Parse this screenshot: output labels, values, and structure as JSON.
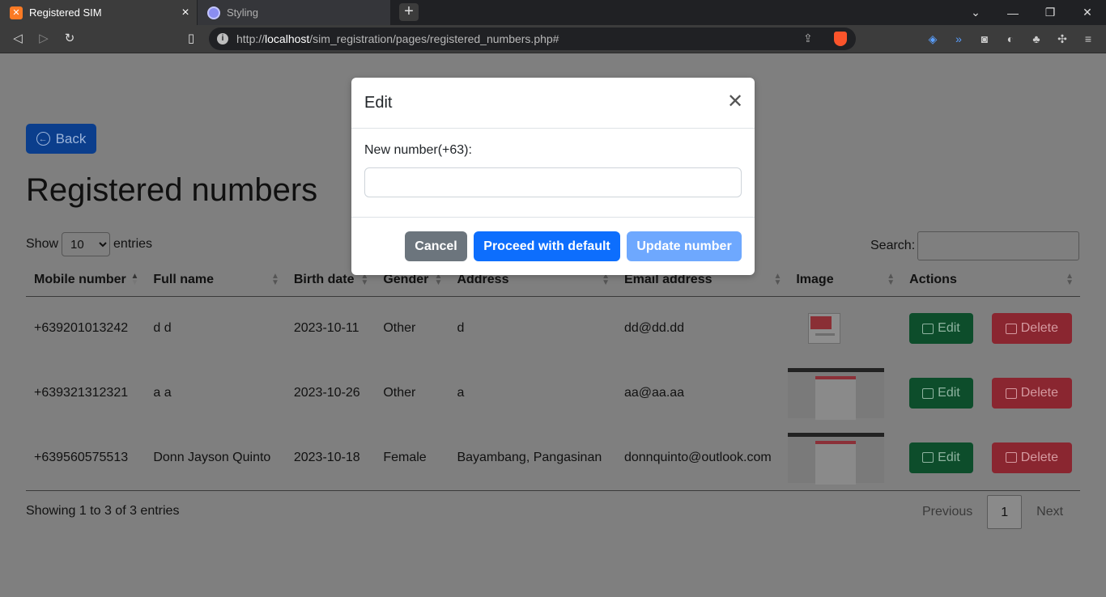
{
  "browser": {
    "tabs": [
      {
        "title": "Registered SIM",
        "icon": "xampp-icon",
        "active": true
      },
      {
        "title": "Styling",
        "icon": "globe-icon",
        "active": false
      }
    ],
    "url_prefix": "http://",
    "url_host": "localhost",
    "url_path": "/sim_registration/pages/registered_numbers.php#"
  },
  "page": {
    "back_label": "Back",
    "title": "Registered numbers",
    "show_label": "Show",
    "entries_label": "entries",
    "length_value": "10",
    "search_label": "Search:",
    "columns": [
      "Mobile number",
      "Full name",
      "Birth date",
      "Gender",
      "Address",
      "Email address",
      "Image",
      "Actions"
    ],
    "rows": [
      {
        "mobile": "+639201013242",
        "name": "d d",
        "birth": "2023-10-11",
        "gender": "Other",
        "address": "d",
        "email": "dd@dd.dd"
      },
      {
        "mobile": "+639321312321",
        "name": "a a",
        "birth": "2023-10-26",
        "gender": "Other",
        "address": "a",
        "email": "aa@aa.aa"
      },
      {
        "mobile": "+639560575513",
        "name": "Donn Jayson Quinto",
        "birth": "2023-10-18",
        "gender": "Female",
        "address": "Bayambang, Pangasinan",
        "email": "donnquinto@outlook.com"
      }
    ],
    "edit_label": "Edit",
    "delete_label": "Delete",
    "info": "Showing 1 to 3 of 3 entries",
    "pager": {
      "previous": "Previous",
      "current": "1",
      "next": "Next"
    }
  },
  "modal": {
    "title": "Edit",
    "label": "New number(+63):",
    "value": "",
    "cancel_label": "Cancel",
    "proceed_label": "Proceed with default",
    "update_label": "Update number"
  },
  "colors": {
    "primary": "#0d6efd",
    "secondary": "#6c757d",
    "success": "#198754",
    "danger": "#dc3545"
  }
}
